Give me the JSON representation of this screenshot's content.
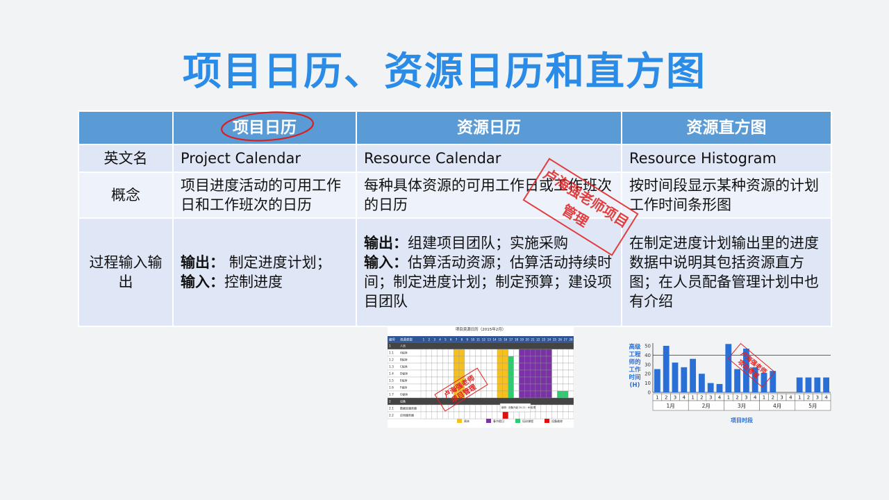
{
  "title": "项目日历、资源日历和直方图",
  "table": {
    "headers": [
      "",
      "项目日历",
      "资源日历",
      "资源直方图"
    ],
    "rows": [
      {
        "label": "英文名",
        "c1": "Project Calendar",
        "c2": "Resource Calendar",
        "c3": "Resource Histogram"
      },
      {
        "label": "概念",
        "c1": "项目进度活动的可用工作日和工作班次的日历",
        "c2": "每种具体资源的可用工作日或工作班次的日历",
        "c3": "按时间段显示某种资源的计划工作时间条形图"
      },
      {
        "label": "过程输入输出",
        "c1_out_k": "输出：",
        "c1_out_v": "制定进度计划；",
        "c1_in_k": "输入：",
        "c1_in_v": "控制进度",
        "c2_out_k": "输出：",
        "c2_out_v": "组建项目团队；实施采购",
        "c2_in_k": "输入：",
        "c2_in_v": "估算活动资源；估算活动持续时间；制定进度计划；制定预算；建设项目团队",
        "c3": "在制定进度计划输出里的进度数据中说明其包括资源直方图；在人员配备管理计划中也有介绍"
      }
    ]
  },
  "stamp": "卢海强老师项目管理",
  "resource_calendar_image": {
    "title": "项目资源日历（2015年2月）",
    "headers": [
      "编号",
      "资源类型"
    ],
    "days": [
      "1",
      "2",
      "3",
      "4",
      "5",
      "6",
      "7",
      "8",
      "9",
      "10",
      "11",
      "12",
      "13",
      "14",
      "15",
      "16",
      "17",
      "18",
      "19",
      "20",
      "21",
      "22",
      "23",
      "24",
      "25",
      "26",
      "27",
      "28"
    ],
    "rows": [
      {
        "id": "1",
        "name": "人员"
      },
      {
        "id": "1.1",
        "name": "A程序"
      },
      {
        "id": "1.2",
        "name": "B程序"
      },
      {
        "id": "1.3",
        "name": "C程序"
      },
      {
        "id": "1.4",
        "name": "D程序"
      },
      {
        "id": "1.5",
        "name": "E程序"
      },
      {
        "id": "1.6",
        "name": "F程序"
      },
      {
        "id": "1.7",
        "name": "G程序"
      },
      {
        "id": "2",
        "name": "设备"
      },
      {
        "id": "2.1",
        "name": "数据库服务器"
      },
      {
        "id": "2.2",
        "name": "应用服务器"
      }
    ],
    "legend": [
      "周末",
      "春节假日",
      "培训课程",
      "设备维修"
    ],
    "legend_colors": [
      "#f5c020",
      "#7a32a6",
      "#2ecc71",
      "#e01010"
    ],
    "note": "维修：设备升级 20-21：60处理"
  },
  "chart_data": {
    "type": "bar",
    "ylabel": "高级工程师的工作时间(H)",
    "xlabel": "项目时段",
    "ylim": [
      0,
      50
    ],
    "yticks": [
      0,
      10,
      20,
      30,
      40,
      50
    ],
    "reference_line": 40,
    "months": [
      "1月",
      "2月",
      "3月",
      "4月",
      "5月"
    ],
    "week_labels": [
      "1",
      "2",
      "3",
      "4",
      "1",
      "2",
      "3",
      "4",
      "1",
      "2",
      "3",
      "4",
      "1",
      "2",
      "3",
      "4",
      "1",
      "2",
      "3",
      "4"
    ],
    "values": [
      25,
      50,
      32,
      27,
      36,
      20,
      10,
      9,
      52,
      25,
      47,
      27,
      21,
      23,
      0,
      0,
      16,
      16,
      16,
      16
    ],
    "color": "#2a6fd6"
  }
}
